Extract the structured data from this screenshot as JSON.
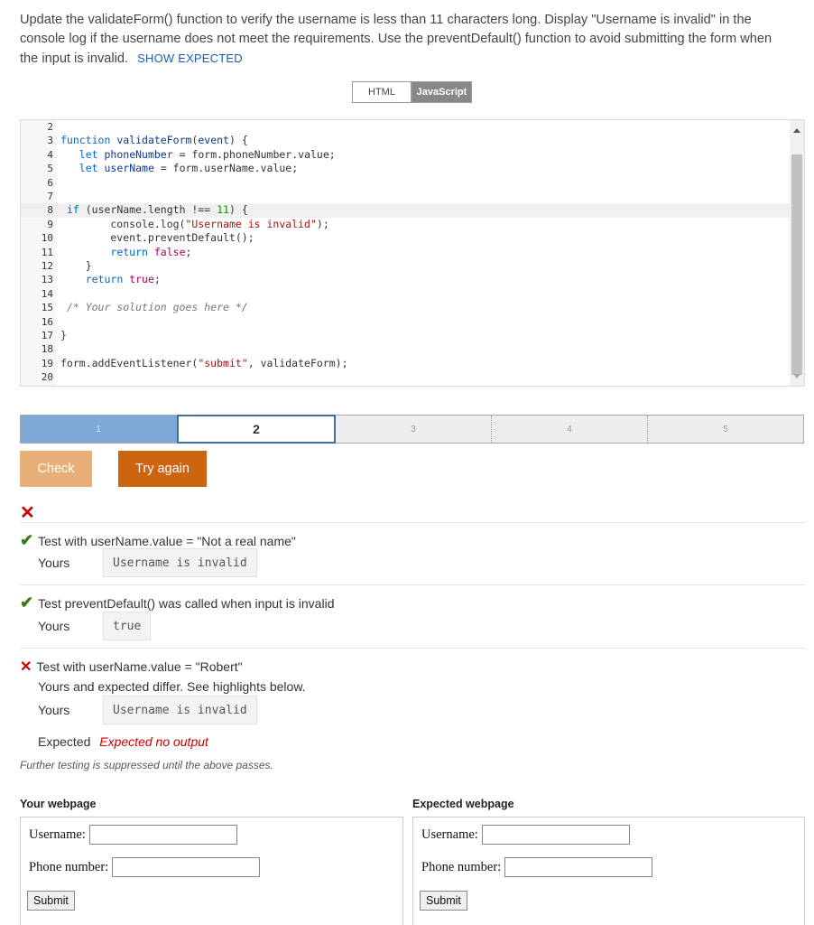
{
  "instructions": {
    "text": "Update the validateForm() function to verify the username is less than 11 characters long. Display \"Username is invalid\" in the console log if the username does not meet the requirements. Use the preventDefault() function to avoid submitting the form when the input is invalid.",
    "show_expected_label": "SHOW EXPECTED"
  },
  "lang_tabs": {
    "html": "HTML",
    "js": "JavaScript"
  },
  "code": {
    "line_numbers": [
      "2",
      "3",
      "4",
      "5",
      "6",
      "7",
      "8",
      "9",
      "10",
      "11",
      "12",
      "13",
      "14",
      "15",
      "16",
      "17",
      "18",
      "19",
      "20"
    ]
  },
  "progress": {
    "steps": [
      "1",
      "2",
      "3",
      "4",
      "5"
    ],
    "current": 2
  },
  "buttons": {
    "check": "Check",
    "try_again": "Try again"
  },
  "results": {
    "overall_icon": "x-icon",
    "test1": {
      "title": "Test with userName.value = \"Not a real name\"",
      "yours_label": "Yours",
      "yours": "Username is invalid",
      "status": "pass"
    },
    "test2": {
      "title": "Test preventDefault() was called when input is invalid",
      "yours_label": "Yours",
      "yours": "true",
      "status": "pass"
    },
    "test3": {
      "title": "Test with userName.value = \"Robert\"",
      "differ": "Yours and expected differ. See highlights below.",
      "yours_label": "Yours",
      "yours": "Username is invalid",
      "expected_label": "Expected",
      "expected": "Expected no output",
      "status": "fail"
    },
    "suppressed": "Further testing is suppressed until the above passes."
  },
  "webpages": {
    "yours_title": "Your webpage",
    "expected_title": "Expected webpage",
    "username_label": "Username:",
    "phone_label": "Phone number:",
    "submit_label": "Submit"
  },
  "colors": {
    "pass": "#3a7a1a",
    "fail": "#cc0000",
    "try_again": "#cc6410",
    "check": "#e8b078",
    "progress_done": "#7fa7d8"
  }
}
